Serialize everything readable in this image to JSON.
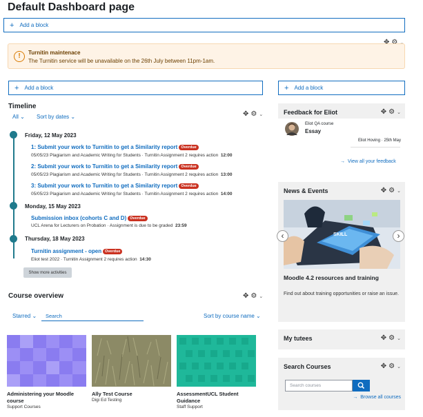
{
  "page": {
    "title": "Default Dashboard page"
  },
  "add_block": {
    "label": "Add a block",
    "plus": "+"
  },
  "alert": {
    "title": "Turnitin maintenace",
    "message": "The Turnitin service will be unavailable on the 26th July between 11pm-1am.",
    "icon_glyph": "!"
  },
  "icons": {
    "move": "✥",
    "gear": "⚙",
    "caret": "⌄"
  },
  "timeline": {
    "heading": "Timeline",
    "filter_all": "All",
    "sort": "Sort by dates",
    "days": [
      {
        "date": "Friday, 12 May 2023",
        "events": [
          {
            "title": "1: Submit your work to Turnitin to get a Similarity report",
            "badge": "Overdue",
            "sub": "05/05/23 Plagiarism and Academic Writing for Students · Turnitin Assignment 2 requires action",
            "time": "12:00"
          },
          {
            "title": "2: Submit your work to Turnitin to get a Similarity report",
            "badge": "Overdue",
            "sub": "05/05/23 Plagiarism and Academic Writing for Students · Turnitin Assignment 2 requires action",
            "time": "13:00"
          },
          {
            "title": "3: Submit your work to Turnitin to get a Similarity report",
            "badge": "Overdue",
            "sub": "05/05/23 Plagiarism and Academic Writing for Students · Turnitin Assignment 2 requires action",
            "time": "14:00"
          }
        ]
      },
      {
        "date": "Monday, 15 May 2023",
        "events": [
          {
            "title": "Submission inbox (cohorts C and D)",
            "badge": "Overdue",
            "sub": "UCL Arena for Lecturers on Probation · Assignment is due to be graded",
            "time": "23:59"
          }
        ]
      },
      {
        "date": "Thursday, 18 May 2023",
        "events": [
          {
            "title": "Turnitin assignment - open",
            "badge": "Overdue",
            "sub": "Eliot test 2022 · Turnitin Assignment 2 requires action",
            "time": "14:30"
          }
        ]
      }
    ],
    "show_more": "Show more activities"
  },
  "course_overview": {
    "heading": "Course overview",
    "filter": "Starred",
    "search_placeholder": "Search",
    "sort": "Sort by course name",
    "courses": [
      {
        "title": "Administering your Moodle course",
        "category": "Support Courses",
        "color": "#9c8ff5"
      },
      {
        "title": "Ally Test Course",
        "category": "Digi Ed Testing",
        "color": "#8a8a6a"
      },
      {
        "title": "AssessmentUCL Student Guidance",
        "category": "Staff Support",
        "color": "#1fb89a"
      }
    ]
  },
  "feedback": {
    "heading": "Feedback for Eliot",
    "course": "Eliot QA course",
    "item": "Essay",
    "meta": "Eliot Hoving · 25th May",
    "view_all": "View all your feedback",
    "arrow": "→"
  },
  "news": {
    "heading": "News & Events",
    "image_text": "SKILL",
    "item_title": "Moodle 4.2 resources and training",
    "item_text": "Find out about training opportunities or raise an issue.",
    "prev": "‹",
    "next": "›"
  },
  "tutees": {
    "heading": "My tutees"
  },
  "search_courses": {
    "heading": "Search Courses",
    "placeholder": "Search courses",
    "browse": "Browse all courses",
    "arrow": "→"
  }
}
